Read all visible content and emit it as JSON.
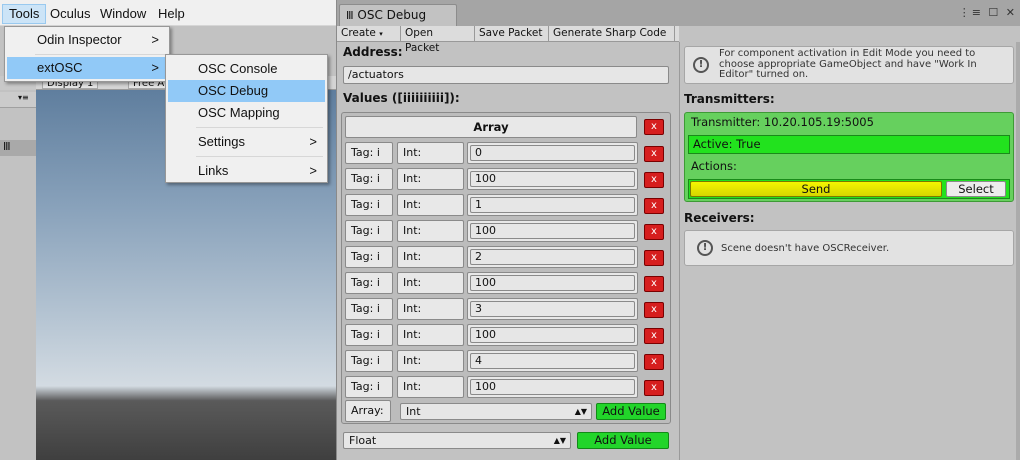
{
  "menubar": {
    "items": [
      "Tools",
      "Oculus",
      "Window",
      "Help"
    ]
  },
  "left_editor": {
    "display_label": "Display 1",
    "aspect_label": "Free A"
  },
  "tools_menu": {
    "items": [
      {
        "label": "Odin Inspector",
        "arrow": ">"
      },
      {
        "label": "extOSC",
        "arrow": ">"
      }
    ]
  },
  "extosc_menu": {
    "items": [
      {
        "label": "OSC Console"
      },
      {
        "label": "OSC Debug"
      },
      {
        "label": "OSC Mapping"
      },
      {
        "label": "Settings",
        "arrow": ">"
      },
      {
        "label": "Links",
        "arrow": ">"
      }
    ]
  },
  "window": {
    "tab_title": "OSC Debug",
    "tab_icon": "osc-columns-icon"
  },
  "toolbar": {
    "create": "Create",
    "open_packet": "Open Packet",
    "save_packet": "Save Packet",
    "generate_code": "Generate Sharp Code"
  },
  "packet": {
    "address_label": "Address:",
    "address_value": "/actuators",
    "values_label": "Values ([iiiiiiiiii]):",
    "array_header": "Array",
    "rows": [
      {
        "tag": "Tag: i",
        "type": "Int:",
        "value": "0"
      },
      {
        "tag": "Tag: i",
        "type": "Int:",
        "value": "100"
      },
      {
        "tag": "Tag: i",
        "type": "Int:",
        "value": "1"
      },
      {
        "tag": "Tag: i",
        "type": "Int:",
        "value": "100"
      },
      {
        "tag": "Tag: i",
        "type": "Int:",
        "value": "2"
      },
      {
        "tag": "Tag: i",
        "type": "Int:",
        "value": "100"
      },
      {
        "tag": "Tag: i",
        "type": "Int:",
        "value": "3"
      },
      {
        "tag": "Tag: i",
        "type": "Int:",
        "value": "100"
      },
      {
        "tag": "Tag: i",
        "type": "Int:",
        "value": "4"
      },
      {
        "tag": "Tag: i",
        "type": "Int:",
        "value": "100"
      }
    ],
    "remove_glyph": "x",
    "array_type_label": "Array:",
    "array_type_value": "Int",
    "add_value": "Add Value",
    "root_type_value": "Float",
    "root_add_value": "Add Value"
  },
  "right_panel": {
    "help_text": "For component activation in Edit Mode you need to choose appropriate GameObject and have \"Work In Editor\" turned on.",
    "transmitters_label": "Transmitters:",
    "transmitter_title": "Transmitter: 10.20.105.19:5005",
    "active_text": "Active: True",
    "actions_label": "Actions:",
    "send_label": "Send",
    "select_label": "Select",
    "receivers_label": "Receivers:",
    "receivers_help": "Scene doesn't have OSCReceiver."
  },
  "colors": {
    "menu_highlight": "#91c9f7",
    "remove_red": "#d61e1e",
    "add_green": "#22d52a",
    "transmitter_green": "#66d05e",
    "active_green": "#22e21e",
    "send_yellow": "#e6e600"
  }
}
